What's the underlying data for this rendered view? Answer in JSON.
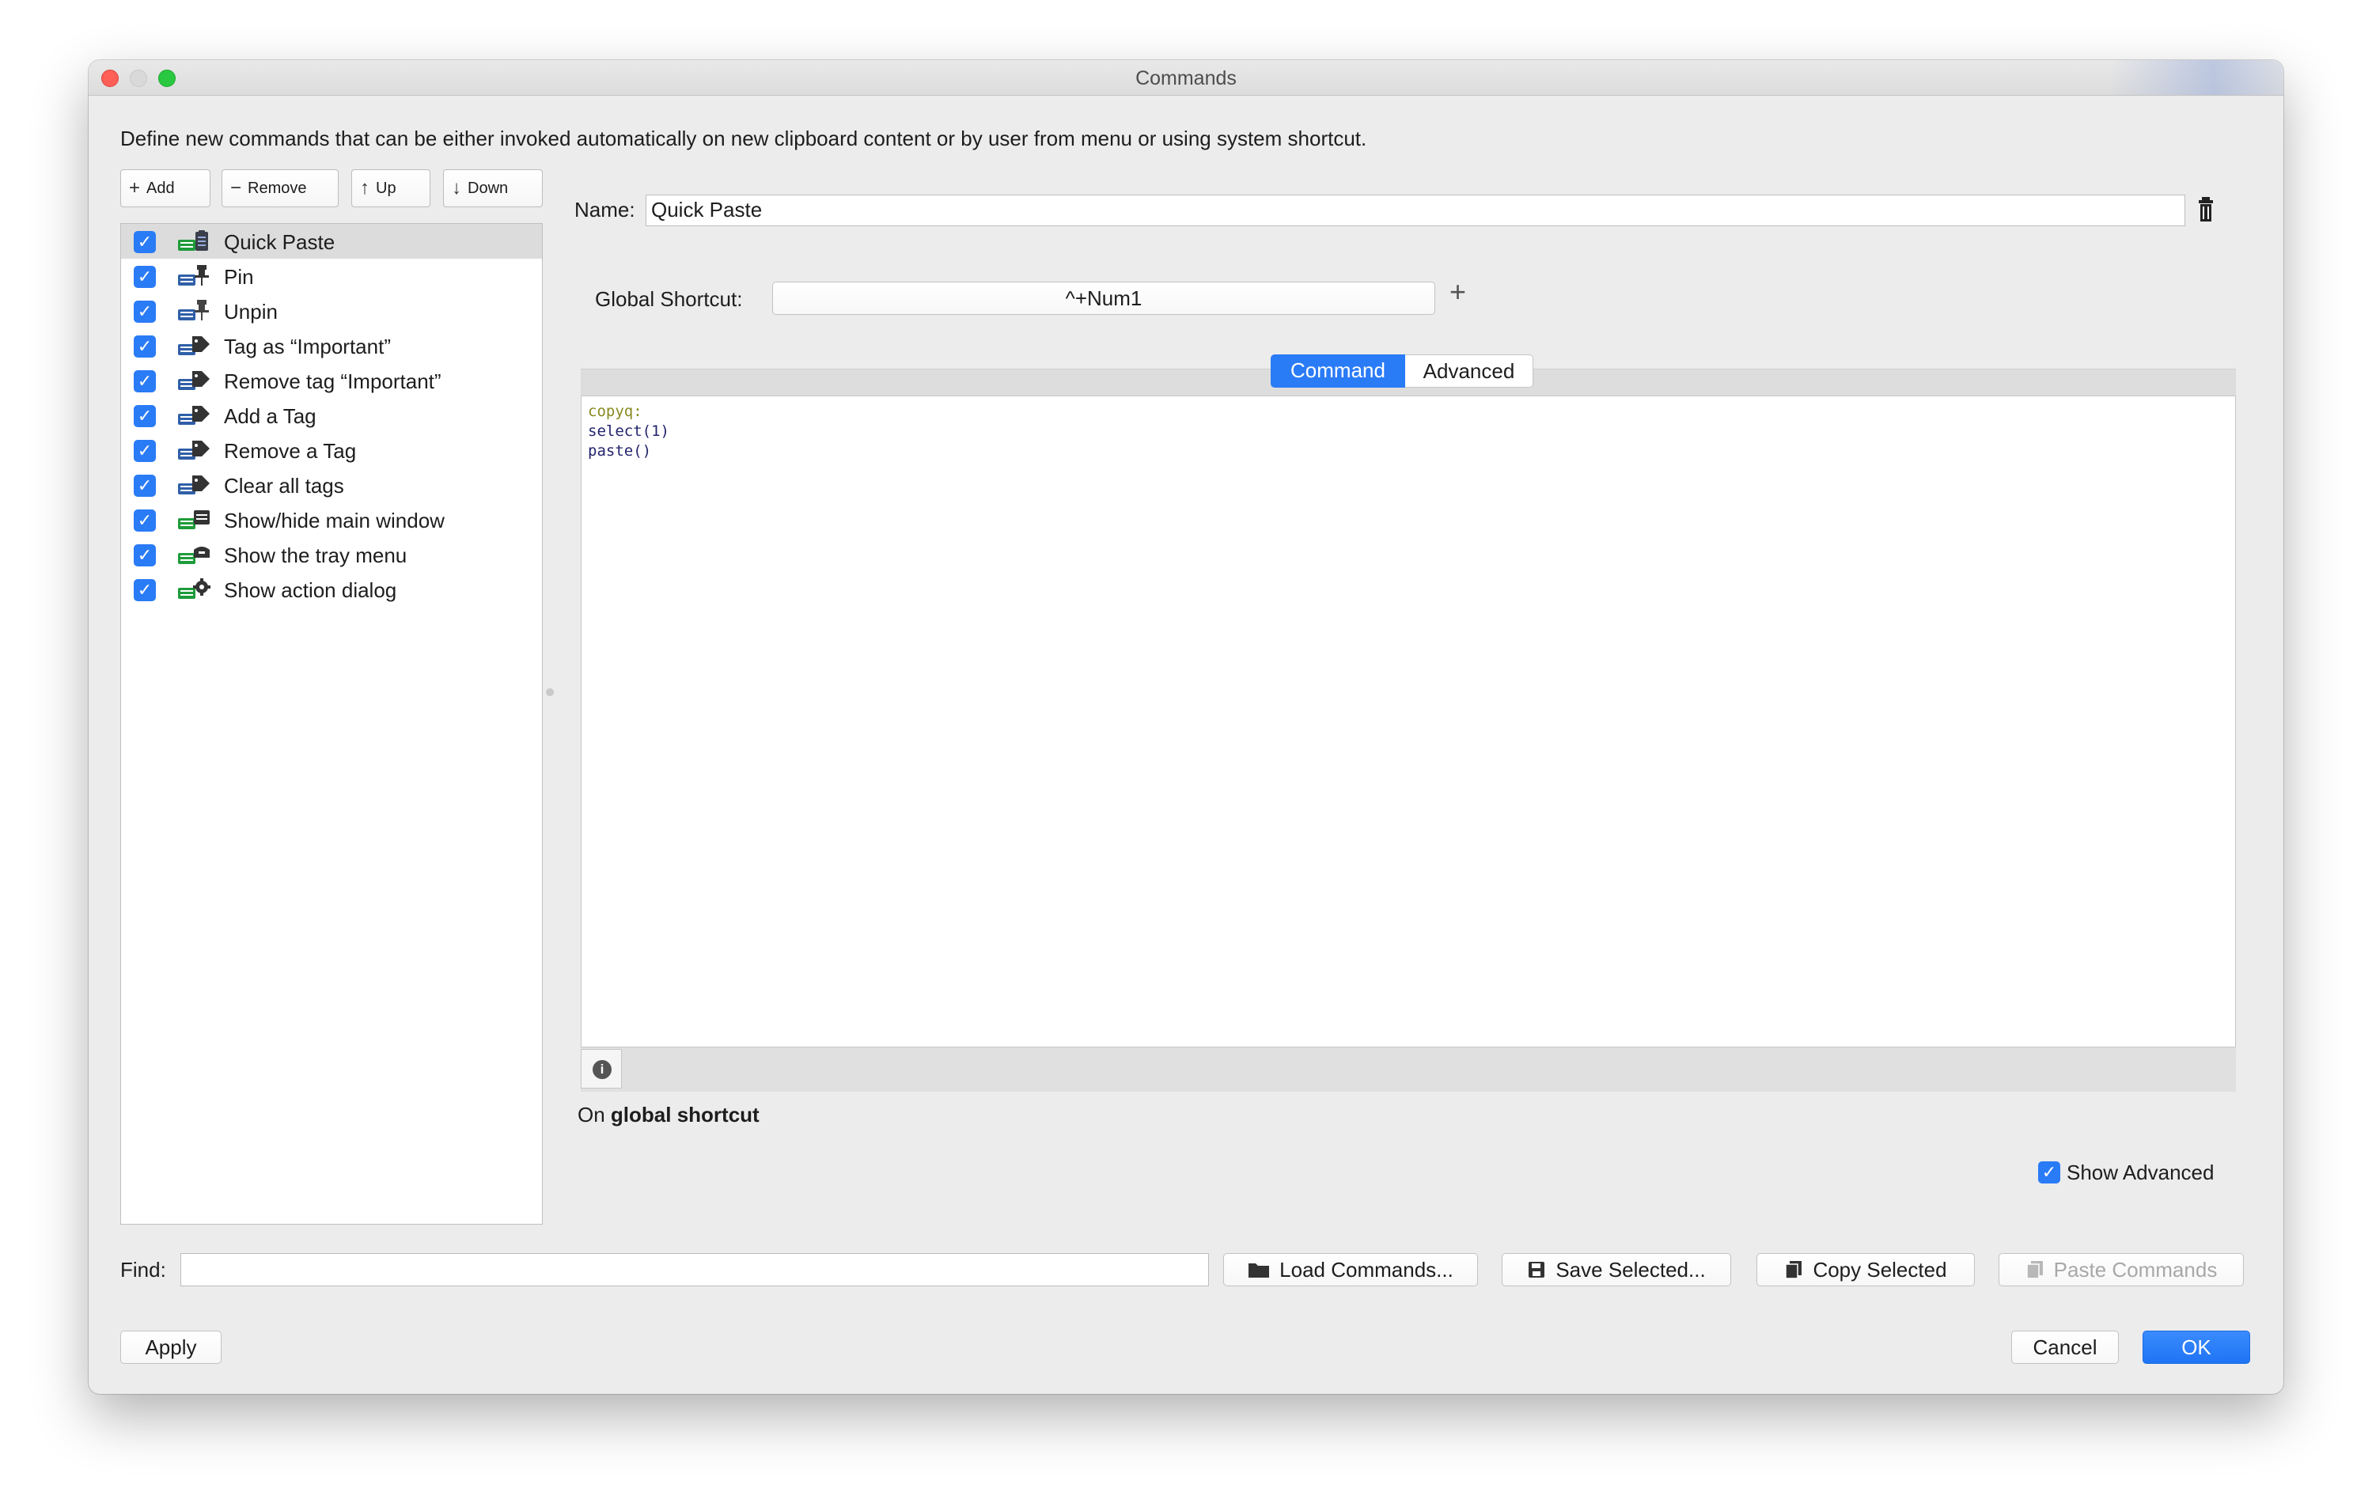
{
  "window": {
    "title": "Commands"
  },
  "description": "Define new commands that can be either invoked automatically on new clipboard content or by user from menu or using system shortcut.",
  "toolbar": {
    "add": "Add",
    "remove": "Remove",
    "up": "Up",
    "down": "Down"
  },
  "commands": [
    {
      "label": "Quick Paste",
      "checked": true,
      "icon": "paste-icon",
      "selected": true
    },
    {
      "label": "Pin",
      "checked": true,
      "icon": "pin-icon"
    },
    {
      "label": "Unpin",
      "checked": true,
      "icon": "unpin-icon"
    },
    {
      "label": "Tag as “Important”",
      "checked": true,
      "icon": "tag-icon"
    },
    {
      "label": "Remove tag “Important”",
      "checked": true,
      "icon": "tag-icon"
    },
    {
      "label": "Add a Tag",
      "checked": true,
      "icon": "tag-icon"
    },
    {
      "label": "Remove a Tag",
      "checked": true,
      "icon": "tag-icon"
    },
    {
      "label": "Clear all tags",
      "checked": true,
      "icon": "tag-icon"
    },
    {
      "label": "Show/hide main window",
      "checked": true,
      "icon": "window-icon"
    },
    {
      "label": "Show the tray menu",
      "checked": true,
      "icon": "tray-icon"
    },
    {
      "label": "Show action dialog",
      "checked": true,
      "icon": "gear-icon"
    }
  ],
  "name": {
    "label": "Name:",
    "value": "Quick Paste"
  },
  "shortcut": {
    "label": "Global Shortcut:",
    "value": "^+Num1"
  },
  "tabs": {
    "command": "Command",
    "advanced": "Advanced",
    "active": "Command"
  },
  "editor": {
    "lines": [
      {
        "text": "copyq:",
        "kind": "keyword"
      },
      {
        "text": "select(1)",
        "kind": "function"
      },
      {
        "text": "paste()",
        "kind": "function"
      }
    ]
  },
  "trigger": {
    "prefix": "On ",
    "bold": "global shortcut"
  },
  "show_advanced": {
    "label": "Show Advanced",
    "checked": true
  },
  "find": {
    "label": "Find:",
    "value": ""
  },
  "buttons": {
    "load": "Load Commands...",
    "save": "Save Selected...",
    "copy": "Copy Selected",
    "paste": "Paste Commands",
    "apply": "Apply",
    "cancel": "Cancel",
    "ok": "OK"
  },
  "colors": {
    "accent": "#2a7bf6",
    "keyword": "#888a20",
    "function": "#23246c"
  }
}
